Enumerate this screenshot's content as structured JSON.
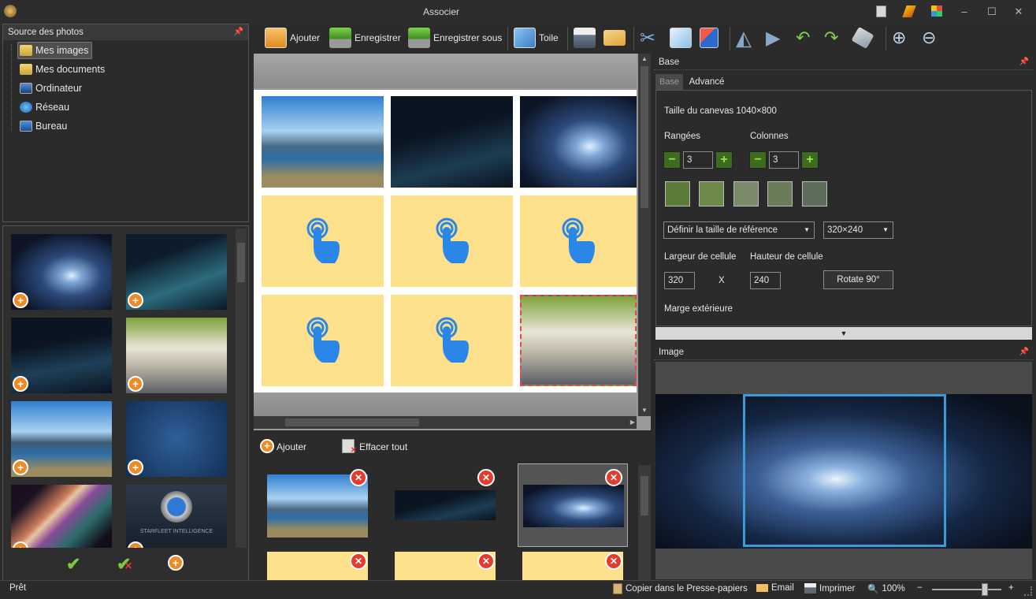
{
  "window": {
    "title": "Associer"
  },
  "toolbar": {
    "add_label": "Ajouter",
    "save_label": "Enregistrer",
    "save_as_label": "Enregistrer sous",
    "canvas_label": "Toile"
  },
  "source_panel": {
    "title": "Source des photos",
    "items": [
      {
        "label": "Mes images"
      },
      {
        "label": "Mes documents"
      },
      {
        "label": "Ordinateur"
      },
      {
        "label": "Réseau"
      },
      {
        "label": "Bureau"
      }
    ]
  },
  "thumb_panel": {
    "stamp_text": "STARFLEET INTELLIGENCE"
  },
  "bottom_strip": {
    "add_label": "Ajouter",
    "clear_label": "Effacer tout"
  },
  "base_panel": {
    "title": "Base",
    "tabs": [
      {
        "label": "Base"
      },
      {
        "label": "Advancé"
      }
    ],
    "canvas_size": "Taille du canevas 1040×800",
    "rows_label": "Rangées",
    "cols_label": "Colonnes",
    "rows_value": "3",
    "cols_value": "3",
    "ref_size_select": "Définir la taille de référence",
    "size_select": "320×240",
    "cell_width_label": "Largeur de cellule",
    "cell_height_label": "Hauteur de cellule",
    "cell_width": "320",
    "cell_height": "240",
    "x_label": "X",
    "rotate_label": "Rotate 90°",
    "margin_label": "Marge extérieure"
  },
  "image_panel": {
    "title": "Image"
  },
  "status": {
    "ready": "Prêt",
    "copy": "Copier dans le Presse-papiers",
    "email": "Email",
    "print": "Imprimer",
    "zoom": "100%",
    "zoom_minus": "−",
    "zoom_plus": "+",
    "zoom_level": 0.8
  },
  "colors": {
    "accent_orange": "#f08a24",
    "delete_red": "#e53b2c",
    "hand_blue": "#2a87e8",
    "cell_yellow": "#fce08c",
    "selection_blue": "#3a9bd8"
  }
}
